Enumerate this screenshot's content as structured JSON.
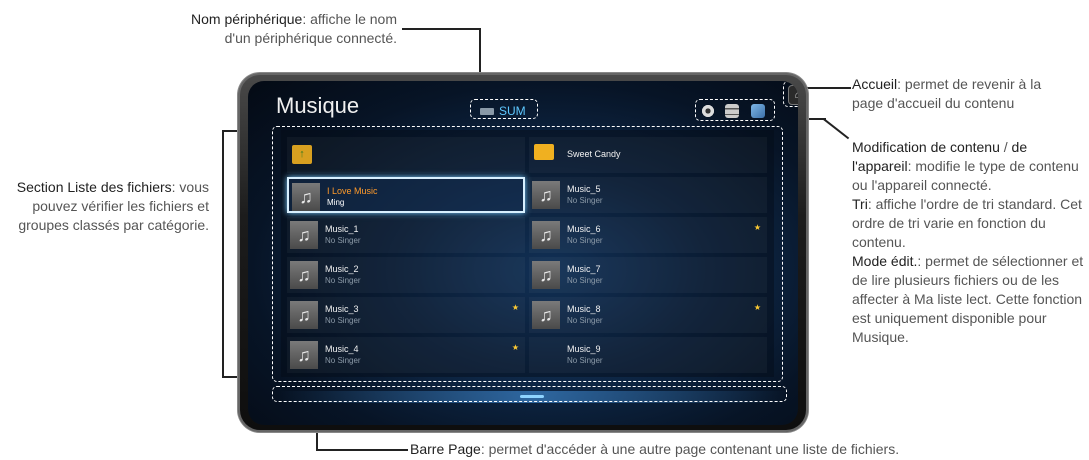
{
  "annotations": {
    "device_name": {
      "title": "Nom périphérique",
      "text": ": affiche le nom",
      "line2": "d'un périphérique connecté."
    },
    "home": {
      "title": "Accueil",
      "text": ": permet de revenir à la",
      "line2": "page d'accueil du contenu"
    },
    "modify": {
      "title": "Modification de contenu",
      "sep": " / ",
      "title2": "de l'appareil",
      "text": ": modifie le type de contenu ou l'appareil connecté."
    },
    "sort": {
      "title": "Tri",
      "text": ": affiche l'ordre de tri standard. Cet ordre de tri varie en fonction du contenu."
    },
    "edit": {
      "title": "Mode édit.",
      "text": ": permet de sélectionner et de lire plusieurs fichiers ou de les affecter à Ma liste lect. Cette fonction est uniquement disponible pour Musique."
    },
    "file_list": {
      "title": "Section Liste des fichiers",
      "text": ": vous pouvez vérifier les fichiers et groupes classés par catégorie."
    },
    "page_bar": {
      "title": "Barre Page",
      "text": ": permet d'accéder à une autre page contenant une liste de fichiers."
    }
  },
  "screen": {
    "title": "Musique",
    "device": "SUM",
    "icons": {
      "home": "home-icon",
      "tools": [
        "gear-icon",
        "sort-icon",
        "edit-icon"
      ]
    }
  },
  "files": {
    "left": [
      {
        "t1": "",
        "t2": "",
        "icon": "folder-up-icon"
      },
      {
        "t1": "I Love Music",
        "t2": "Ming",
        "icon": "music-note-icon",
        "selected": true
      },
      {
        "t1": "Music_1",
        "t2": "No Singer",
        "icon": "music-note-icon"
      },
      {
        "t1": "Music_2",
        "t2": "No Singer",
        "icon": "music-note-icon"
      },
      {
        "t1": "Music_3",
        "t2": "No Singer",
        "icon": "music-note-icon",
        "star": true
      },
      {
        "t1": "Music_4",
        "t2": "No Singer",
        "icon": "music-note-icon",
        "star": true
      }
    ],
    "right": [
      {
        "t1": "Sweet Candy",
        "t2": "",
        "icon": "folder-icon"
      },
      {
        "t1": "Music_5",
        "t2": "No Singer",
        "icon": "music-note-icon"
      },
      {
        "t1": "Music_6",
        "t2": "No Singer",
        "icon": "music-note-icon",
        "star": true
      },
      {
        "t1": "Music_7",
        "t2": "No Singer",
        "icon": "music-note-icon"
      },
      {
        "t1": "Music_8",
        "t2": "No Singer",
        "icon": "music-note-icon",
        "star": true
      },
      {
        "t1": "Music_9",
        "t2": "No Singer",
        "icon": "none"
      }
    ]
  },
  "symbols": {
    "note": "♫",
    "star": "★",
    "home": "⌂",
    "folder_up": "↑"
  },
  "colors": {
    "accent": "#5ec8ff",
    "selected_text": "#ff9a2a",
    "star": "#ffcc33"
  }
}
